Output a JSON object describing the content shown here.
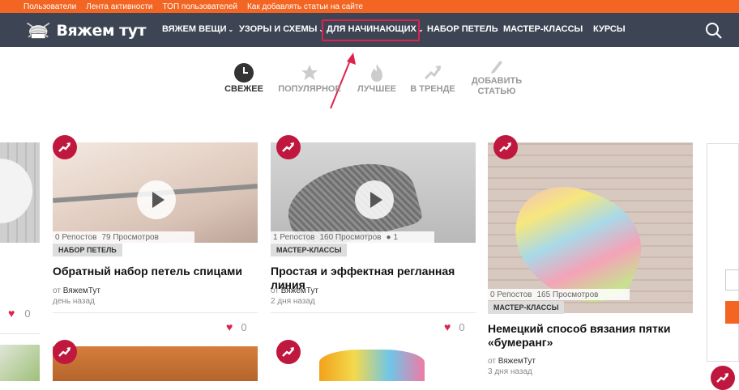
{
  "topbar": {
    "links": [
      "Пользователи",
      "Лента активности",
      "ТОП пользователей",
      "Как добавлять статьи на сайте"
    ]
  },
  "navbar": {
    "logo_text": "Вяжем тут",
    "items": [
      {
        "label": "ВЯЖЕМ ВЕЩИ",
        "dropdown": true
      },
      {
        "label": "УЗОРЫ И СХЕМЫ",
        "dropdown": true
      },
      {
        "label": "ДЛЯ НАЧИНАЮЩИХ",
        "dropdown": true
      },
      {
        "label": "НАБОР ПЕТЕЛЬ",
        "dropdown": false
      },
      {
        "label": "МАСТЕР-КЛАССЫ",
        "dropdown": false
      },
      {
        "label": "КУРСЫ",
        "dropdown": false
      }
    ],
    "search_icon": "search-icon"
  },
  "tabs": [
    {
      "label": "СВЕЖЕЕ",
      "icon": "clock-icon",
      "active": true
    },
    {
      "label": "ПОПУЛЯРНОЕ",
      "icon": "star-icon",
      "active": false
    },
    {
      "label": "ЛУЧШЕЕ",
      "icon": "flame-icon",
      "active": false
    },
    {
      "label": "В ТРЕНДЕ",
      "icon": "trend-icon",
      "active": false
    },
    {
      "label": "ДОБАВИТЬ СТАТЬЮ",
      "icon": "pencil-icon",
      "active": false
    }
  ],
  "cards": [
    {
      "reposts": "0 Репостов",
      "views": "79 Просмотров",
      "comments": "",
      "category": "НАБОР ПЕТЕЛЬ",
      "title": "Обратный набор петель спицами",
      "author_prefix": "от",
      "author": "ВяжемТут",
      "time": "день назад",
      "likes": "0"
    },
    {
      "reposts": "1 Репостов",
      "views": "160 Просмотров",
      "comments": "1",
      "category": "МАСТЕР-КЛАССЫ",
      "title": "Простая и эффектная регланная линия",
      "author_prefix": "от",
      "author": "ВяжемТут",
      "time": "2 дня назад",
      "likes": "0"
    },
    {
      "reposts": "0 Репостов",
      "views": "165 Просмотров",
      "comments": "",
      "category": "МАСТЕР-КЛАССЫ",
      "title": "Немецкий способ вязания пятки «бумеранг»",
      "author_prefix": "от",
      "author": "ВяжемТут",
      "time": "3 дня назад",
      "likes": ""
    }
  ],
  "left_card": {
    "likes": "0"
  },
  "colors": {
    "accent": "#f26522",
    "nav_bg": "#3d4554",
    "badge": "#c0173f",
    "highlight": "#e0214c"
  }
}
